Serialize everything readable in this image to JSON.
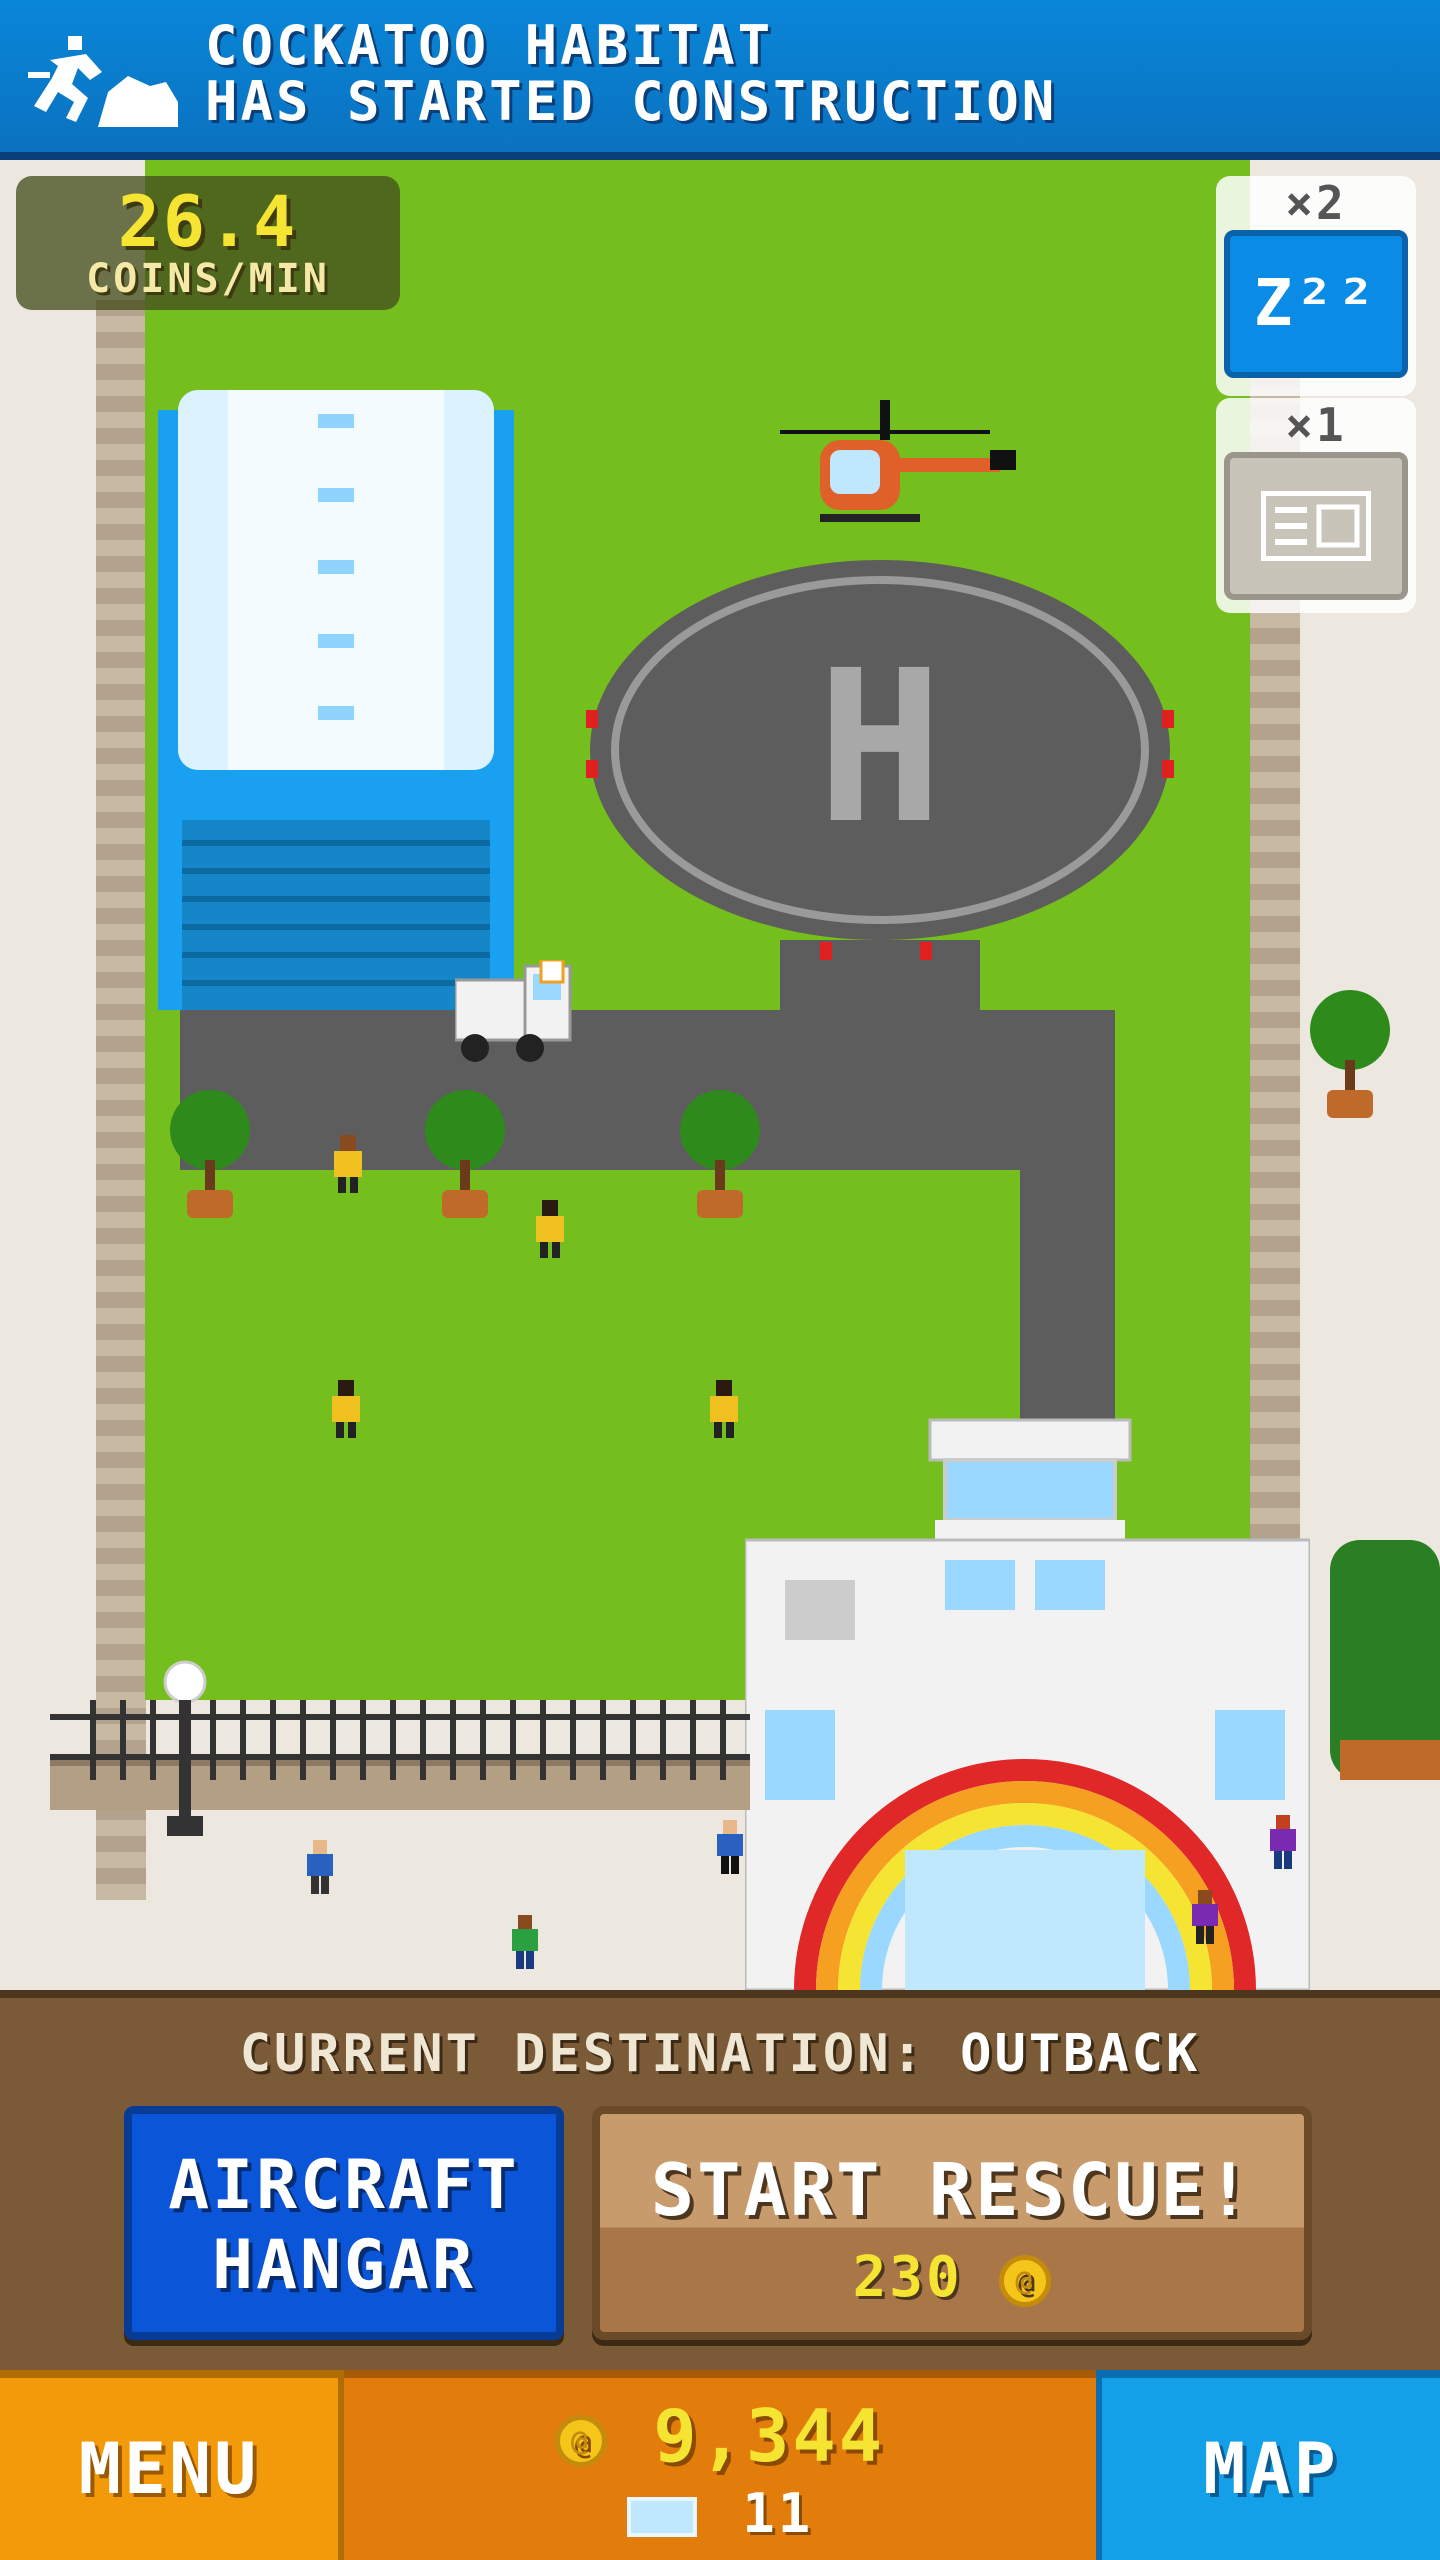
{
  "notification": {
    "line1": "COCKATOO HABITAT",
    "line2": "HAS STARTED CONSTRUCTION",
    "icon": "runner-icon"
  },
  "income": {
    "rate": "26.4",
    "unit": "COINS/MIN"
  },
  "boosters": [
    {
      "multiplier": "×2",
      "label": "z²²",
      "icon": "sleep-icon"
    },
    {
      "multiplier": "×1",
      "label": "",
      "icon": "newspaper-icon"
    }
  ],
  "scene": {
    "helipad_letter": "H"
  },
  "panel": {
    "destination_label": "CURRENT DESTINATION:",
    "destination_value": "OUTBACK",
    "hangar_line1": "AIRCRAFT",
    "hangar_line2": "HANGAR",
    "rescue_label": "START RESCUE!",
    "rescue_cost": "230"
  },
  "nav": {
    "menu_label": "MENU",
    "coins": "9,344",
    "tickets": "11",
    "map_label": "MAP"
  },
  "colors": {
    "banner": "#0a80d0",
    "grass": "#74be1d",
    "hangar_button": "#0a55d8",
    "rescue_button": "#b5835a",
    "menu": "#f29a0a",
    "wallet": "#e27d0c",
    "map": "#14a0e8"
  }
}
